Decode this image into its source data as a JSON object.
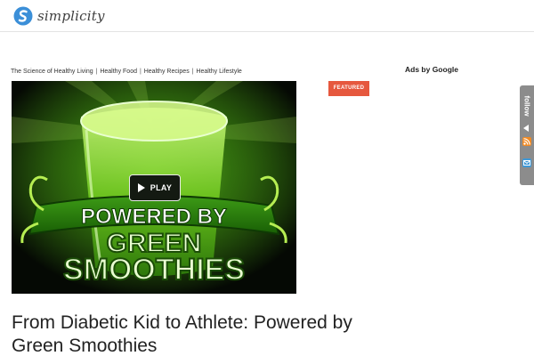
{
  "header": {
    "logo_text": "simplicity"
  },
  "breadcrumb": {
    "items": [
      "The Science of Healthy Living",
      "Healthy Food",
      "Healthy Recipes",
      "Healthy Lifestyle"
    ],
    "separator": "|"
  },
  "sidebar": {
    "ads_title": "Ads by Google"
  },
  "post": {
    "featured_badge": "FEATURED",
    "play_label": "PLAY",
    "hero_text_line1": "POWERED BY",
    "hero_text_line2": "GREEN",
    "hero_text_line3": "SMOOTHIES",
    "title": "From Diabetic Kid to Athlete: Powered by Green Smoothies"
  },
  "follow_tab": {
    "label": "follow",
    "icons": [
      "rss-icon",
      "email-icon"
    ]
  },
  "colors": {
    "accent_badge": "#e6583e",
    "logo_blue": "#3b8fd8",
    "follow_tab": "#8c8c8c",
    "smoothie_green": "#8edb3a"
  }
}
